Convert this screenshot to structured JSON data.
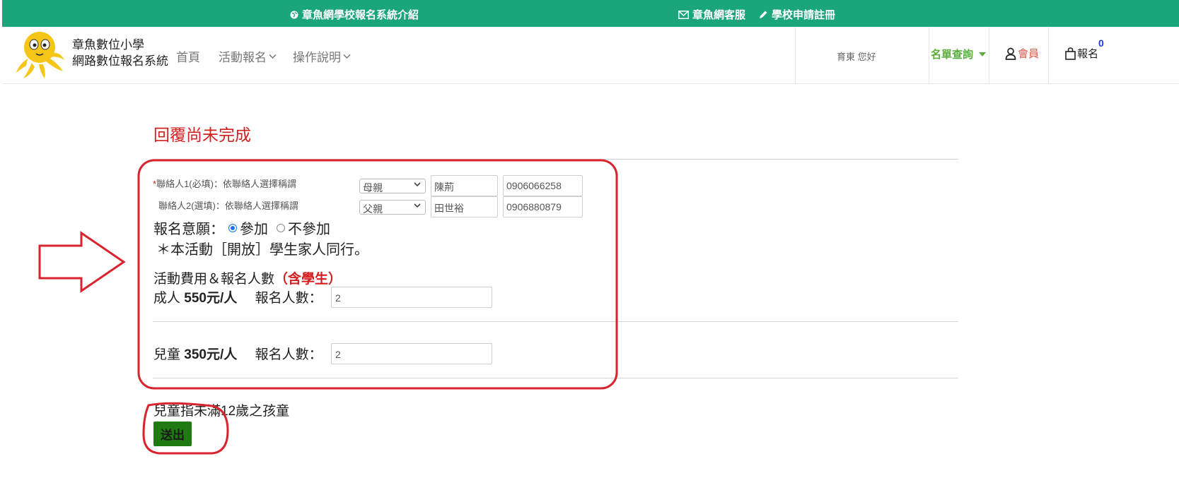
{
  "topbar": {
    "intro_label": "章魚網學校報名系統介紹",
    "service_label": "章魚網客服",
    "register_label": "學校申請註冊"
  },
  "header": {
    "brand_line1": "章魚數位小學",
    "brand_line2": "網路數位報名系統",
    "nav": [
      {
        "label": "首頁"
      },
      {
        "label": "活動報名"
      },
      {
        "label": "操作說明"
      }
    ],
    "greeting": "育東 您好",
    "query_label": "名單查詢",
    "member_label": "會員",
    "cart_label": "報名",
    "cart_count": "0"
  },
  "form": {
    "title": "回覆尚未完成",
    "contact1": {
      "required_mark": "*",
      "label": "聯絡人1(必填)：依聯絡人選擇稱謂",
      "relation": "母親",
      "name": "陳荊",
      "phone": "0906066258"
    },
    "contact2": {
      "label": "聯絡人2(選填)：依聯絡人選擇稱謂",
      "relation": "父親",
      "name": "田世裕",
      "phone": "0906880879"
    },
    "intent_label": "報名意願：",
    "intent_options": [
      "參加",
      "不參加"
    ],
    "intent_selected": "參加",
    "note": "＊本活動［開放］學生家人同行。",
    "fee_heading": "活動費用＆報名人數",
    "fee_heading_red": "（含學生）",
    "adult": {
      "label": "成人",
      "price": "550元/人",
      "count_label": "報名人數：",
      "count": "2"
    },
    "child": {
      "label": "兒童",
      "price": "350元/人",
      "count_label": "報名人數：",
      "count": "2"
    },
    "child_note": "兒童指未滿12歲之孩童",
    "submit_label": "送出"
  },
  "colors": {
    "topbar": "#1ba57a",
    "title_red": "#d22020",
    "annotation_red": "#d9232e",
    "submit_green": "#1f7a12",
    "query_green": "#5aaf3c"
  }
}
